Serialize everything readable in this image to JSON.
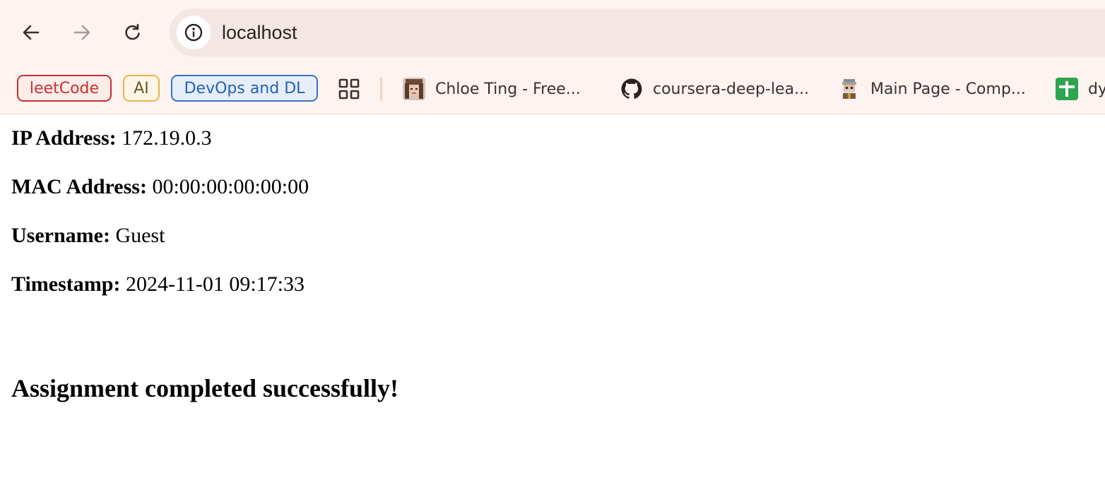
{
  "browser": {
    "url": "localhost",
    "nav": {
      "back_icon": "arrow-left-icon",
      "forward_icon": "arrow-right-icon",
      "reload_icon": "reload-icon",
      "site_info_icon": "info-circle-icon"
    },
    "bookmarks_bar": {
      "chips": [
        {
          "label": "leetCode",
          "color": "#c9302c"
        },
        {
          "label": "AI",
          "color": "#e8b54a"
        },
        {
          "label": "DevOps and DL",
          "color": "#3772c6"
        }
      ],
      "apps_icon": "apps-grid-icon",
      "items": [
        {
          "label": "Chloe Ting - Free...",
          "icon": "avatar-favicon"
        },
        {
          "label": "coursera-deep-lea...",
          "icon": "github-icon"
        },
        {
          "label": "Main Page - Comp...",
          "icon": "pixel-character-favicon"
        },
        {
          "label": "dy",
          "icon": "green-plus-favicon"
        }
      ]
    }
  },
  "page": {
    "ip": {
      "label": "IP Address:",
      "value": "172.19.0.3"
    },
    "mac": {
      "label": "MAC Address:",
      "value": "00:00:00:00:00:00"
    },
    "username": {
      "label": "Username:",
      "value": "Guest"
    },
    "timestamp": {
      "label": "Timestamp:",
      "value": "2024-11-01 09:17:33"
    },
    "success_message": "Assignment completed successfully!"
  }
}
